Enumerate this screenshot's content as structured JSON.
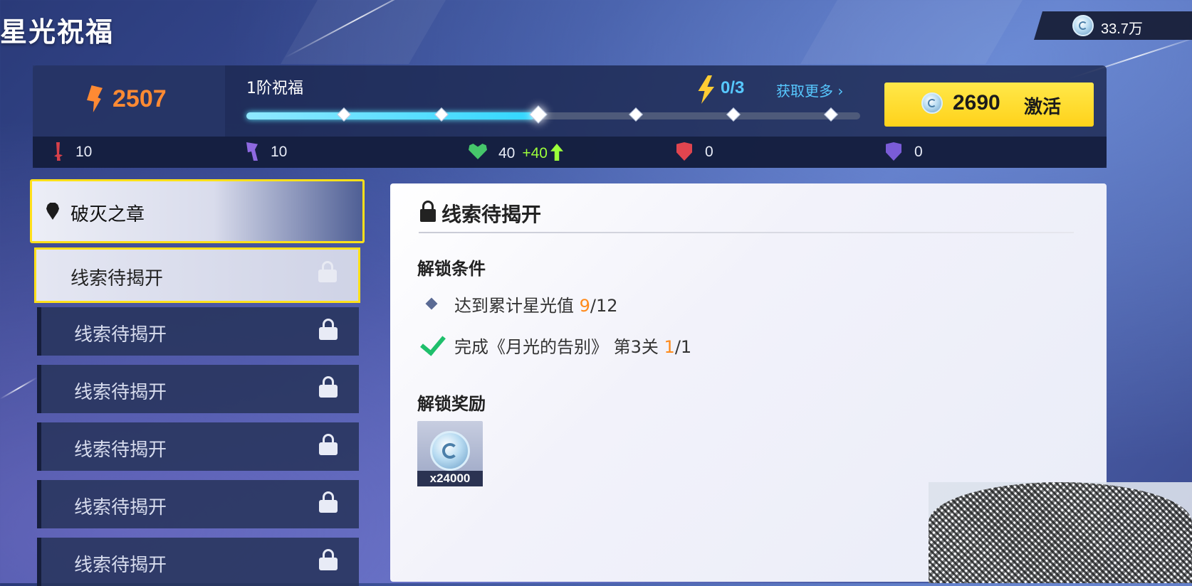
{
  "title": "星光祝福",
  "currency": {
    "value": "33.7万",
    "icon": "starlight-coin-icon"
  },
  "score": {
    "value": "2507",
    "icon": "flame-icon",
    "color": "#ff8a33"
  },
  "tier": {
    "label": "1阶祝福",
    "progress_fraction": 0.47,
    "nodes": 6,
    "current_node": 3
  },
  "energy": {
    "value": "0/3",
    "get_more_label": "获取更多 ›"
  },
  "activate": {
    "cost": "2690",
    "label": "激活"
  },
  "stats": [
    {
      "icon": "sword-icon",
      "value": "10"
    },
    {
      "icon": "claw-icon",
      "value": "10"
    },
    {
      "icon": "heart-icon",
      "value": "40",
      "bonus": "+40"
    },
    {
      "icon": "shield-icon",
      "value": "0"
    },
    {
      "icon": "shield-bolt-icon",
      "value": "0"
    }
  ],
  "chapter": {
    "label": "破灭之章"
  },
  "clues": [
    {
      "label": "线索待揭开"
    },
    {
      "label": "线索待揭开"
    },
    {
      "label": "线索待揭开"
    },
    {
      "label": "线索待揭开"
    },
    {
      "label": "线索待揭开"
    },
    {
      "label": "线索待揭开"
    }
  ],
  "detail": {
    "title": "线索待揭开",
    "conditions_title": "解锁条件",
    "condition1": {
      "text": "达到累计星光值 ",
      "current": "9",
      "total": "/12"
    },
    "condition2": {
      "text": "完成《月光的告别》 第3关 ",
      "current": "1",
      "total": "/1"
    },
    "reward_title": "解锁奖励",
    "reward": {
      "icon": "starlight-coin-icon",
      "quantity": "x24000"
    }
  }
}
